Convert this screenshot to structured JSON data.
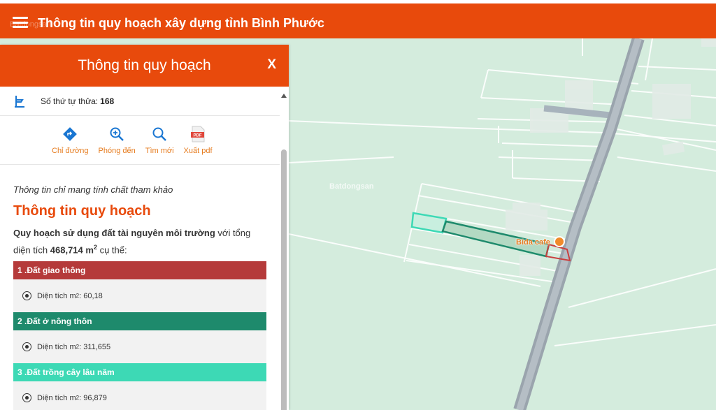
{
  "app": {
    "title": "Thông tin quy hoạch xây dựng tỉnh Bình Phước",
    "brand_watermark": "Batdongsan"
  },
  "panel": {
    "title": "Thông tin quy hoạch",
    "close_label": "X",
    "parcel": {
      "label": "Số thứ tự thửa:",
      "value": "168"
    },
    "actions": [
      {
        "label": "Chỉ đường",
        "icon": "directions-icon"
      },
      {
        "label": "Phóng đến",
        "icon": "zoom-in-icon"
      },
      {
        "label": "Tìm mới",
        "icon": "search-icon"
      },
      {
        "label": "Xuất pdf",
        "icon": "pdf-icon"
      }
    ],
    "note": "Thông tin chỉ mang tính chất tham khảo",
    "section_title": "Thông tin quy hoạch",
    "summary": {
      "bold_prefix": "Quy hoạch sử dụng đất tài nguyên môi trường",
      "middle": " với tổng diện tích ",
      "total": "468,714 m",
      "total_sup": "2",
      "suffix": " cụ thể:"
    },
    "categories": [
      {
        "title": "1 .Đất giao thông",
        "area_label": "Diện tích m",
        "area_sup": "2",
        "area_value": ": 60,18",
        "color": "#b53a3a"
      },
      {
        "title": "2 .Đất ở nông thôn",
        "area_label": "Diện tích m",
        "area_sup": "2",
        "area_value": ": 311,655",
        "color": "#1e8a6c"
      },
      {
        "title": "3 .Đất trồng cây lâu năm",
        "area_label": "Diện tích m",
        "area_sup": "2",
        "area_value": ": 96,879",
        "color": "#3dd9b5"
      }
    ]
  },
  "map": {
    "watermark": "Batdongsan",
    "poi": {
      "label": "Bida cafe",
      "icon": "pin-icon"
    }
  },
  "colors": {
    "primary": "#e84a0c",
    "action": "#e67c1f",
    "map_bg": "#d4ecdd"
  }
}
